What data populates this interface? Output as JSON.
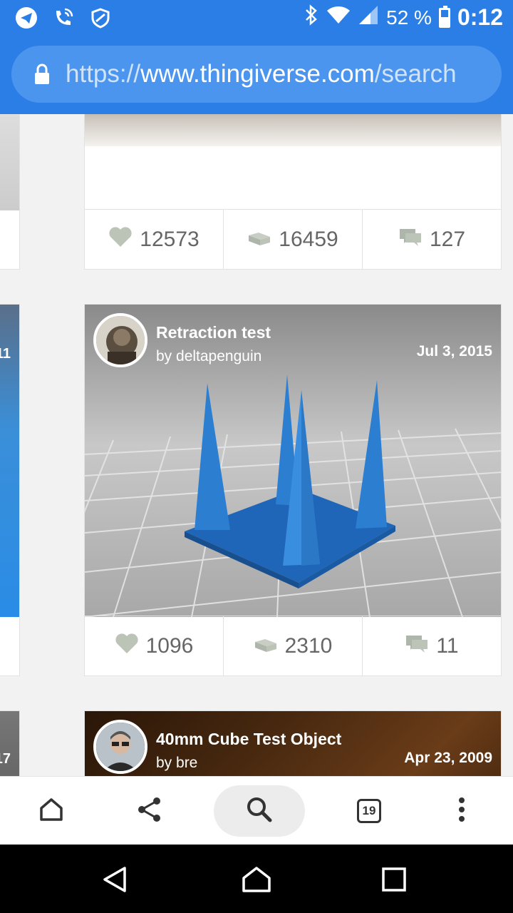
{
  "status_bar": {
    "battery_text": "52 %",
    "battery_level": 0.52,
    "time": "0:12",
    "icons": [
      "telegram-icon",
      "wifi-call-icon",
      "data-saver-icon",
      "bluetooth-icon",
      "wifi-icon",
      "signal-icon",
      "battery-icon"
    ]
  },
  "url_bar": {
    "scheme": "https://",
    "host": "www.thingiverse.com",
    "path": "/search"
  },
  "cards": [
    {
      "stats": {
        "likes": "12573",
        "collects": "16459",
        "comments": "127"
      }
    },
    {
      "title": "Retraction test",
      "author": "by deltapenguin",
      "date": "Jul 3, 2015",
      "stats": {
        "likes": "1096",
        "collects": "2310",
        "comments": "11"
      }
    },
    {
      "title": "40mm Cube Test Object",
      "author": "by bre",
      "date": "Apr 23, 2009"
    }
  ],
  "left_column": {
    "partial_numbers": [
      "11",
      "17"
    ]
  },
  "toolbar": {
    "tabs_count": "19"
  },
  "colors": {
    "accent": "#2a7ee6",
    "url_pill": "#4c95ee",
    "stat_icon": "#bcc4b8",
    "print_blue": "#2c7fd0"
  }
}
